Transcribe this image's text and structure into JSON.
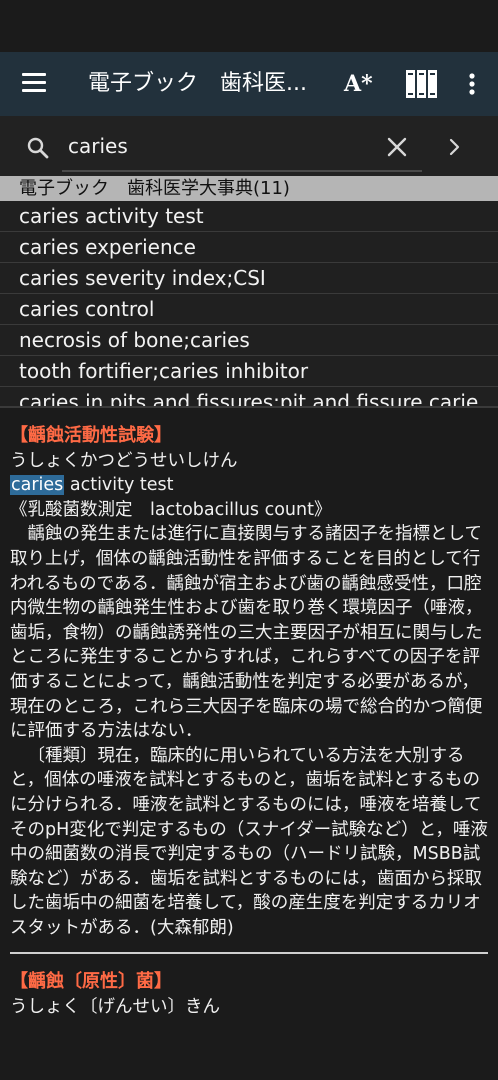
{
  "app_bar": {
    "title": "電子ブック　歯科医...",
    "font_size_label": "A*"
  },
  "search": {
    "value": "caries",
    "placeholder": ""
  },
  "results": {
    "header": "電子ブック　歯科医学大事典(11)",
    "items": [
      "caries activity test",
      "caries experience",
      "caries severity index;CSI",
      "caries control",
      "necrosis of bone;caries",
      "tooth fortifier;caries inhibitor",
      "caries in pits and fissures;pit and fissure carie"
    ]
  },
  "entry1": {
    "title": "【齲蝕活動性試験】",
    "reading": "うしょくかつどうせいしけん",
    "term_highlight": "caries",
    "term_rest": " activity test",
    "alias": "《乳酸菌数測定　lactobacillus count》",
    "paragraph1": "齲蝕の発生または進行に直接関与する諸因子を指標として取り上げ，個体の齲蝕活動性を評価することを目的として行われるものである．齲蝕が宿主および歯の齲蝕感受性，口腔内微生物の齲蝕発生性および歯を取り巻く環境因子（唾液，歯垢，食物）の齲蝕誘発性の三大主要因子が相互に関与したところに発生することからすれば，これらすべての因子を評価することによって，齲蝕活動性を判定する必要があるが，現在のところ，これら三大因子を臨床の場で総合的かつ簡便に評価する方法はない．",
    "paragraph2": "〔種類〕現在，臨床的に用いられている方法を大別すると，個体の唾液を試料とするものと，歯垢を試料とするものに分けられる．唾液を試料とするものには，唾液を培養してそのpH変化で判定するもの（スナイダー試験など）と，唾液中の細菌数の消長で判定するもの（ハードリ試験，MSBB試験など）がある．歯垢を試料とするものには，歯面から採取した歯垢中の細菌を培養して，酸の産生度を判定するカリオスタットがある．(大森郁朗)"
  },
  "entry2": {
    "title": "【齲蝕〔原性〕菌】",
    "reading": "うしょく〔げんせい〕きん"
  },
  "colors": {
    "app_bar": "#22313c",
    "background": "#1b1b1b",
    "entry_title": "#ff6a45",
    "highlight": "#2e6b99",
    "results_header": "#b5b5b5"
  }
}
